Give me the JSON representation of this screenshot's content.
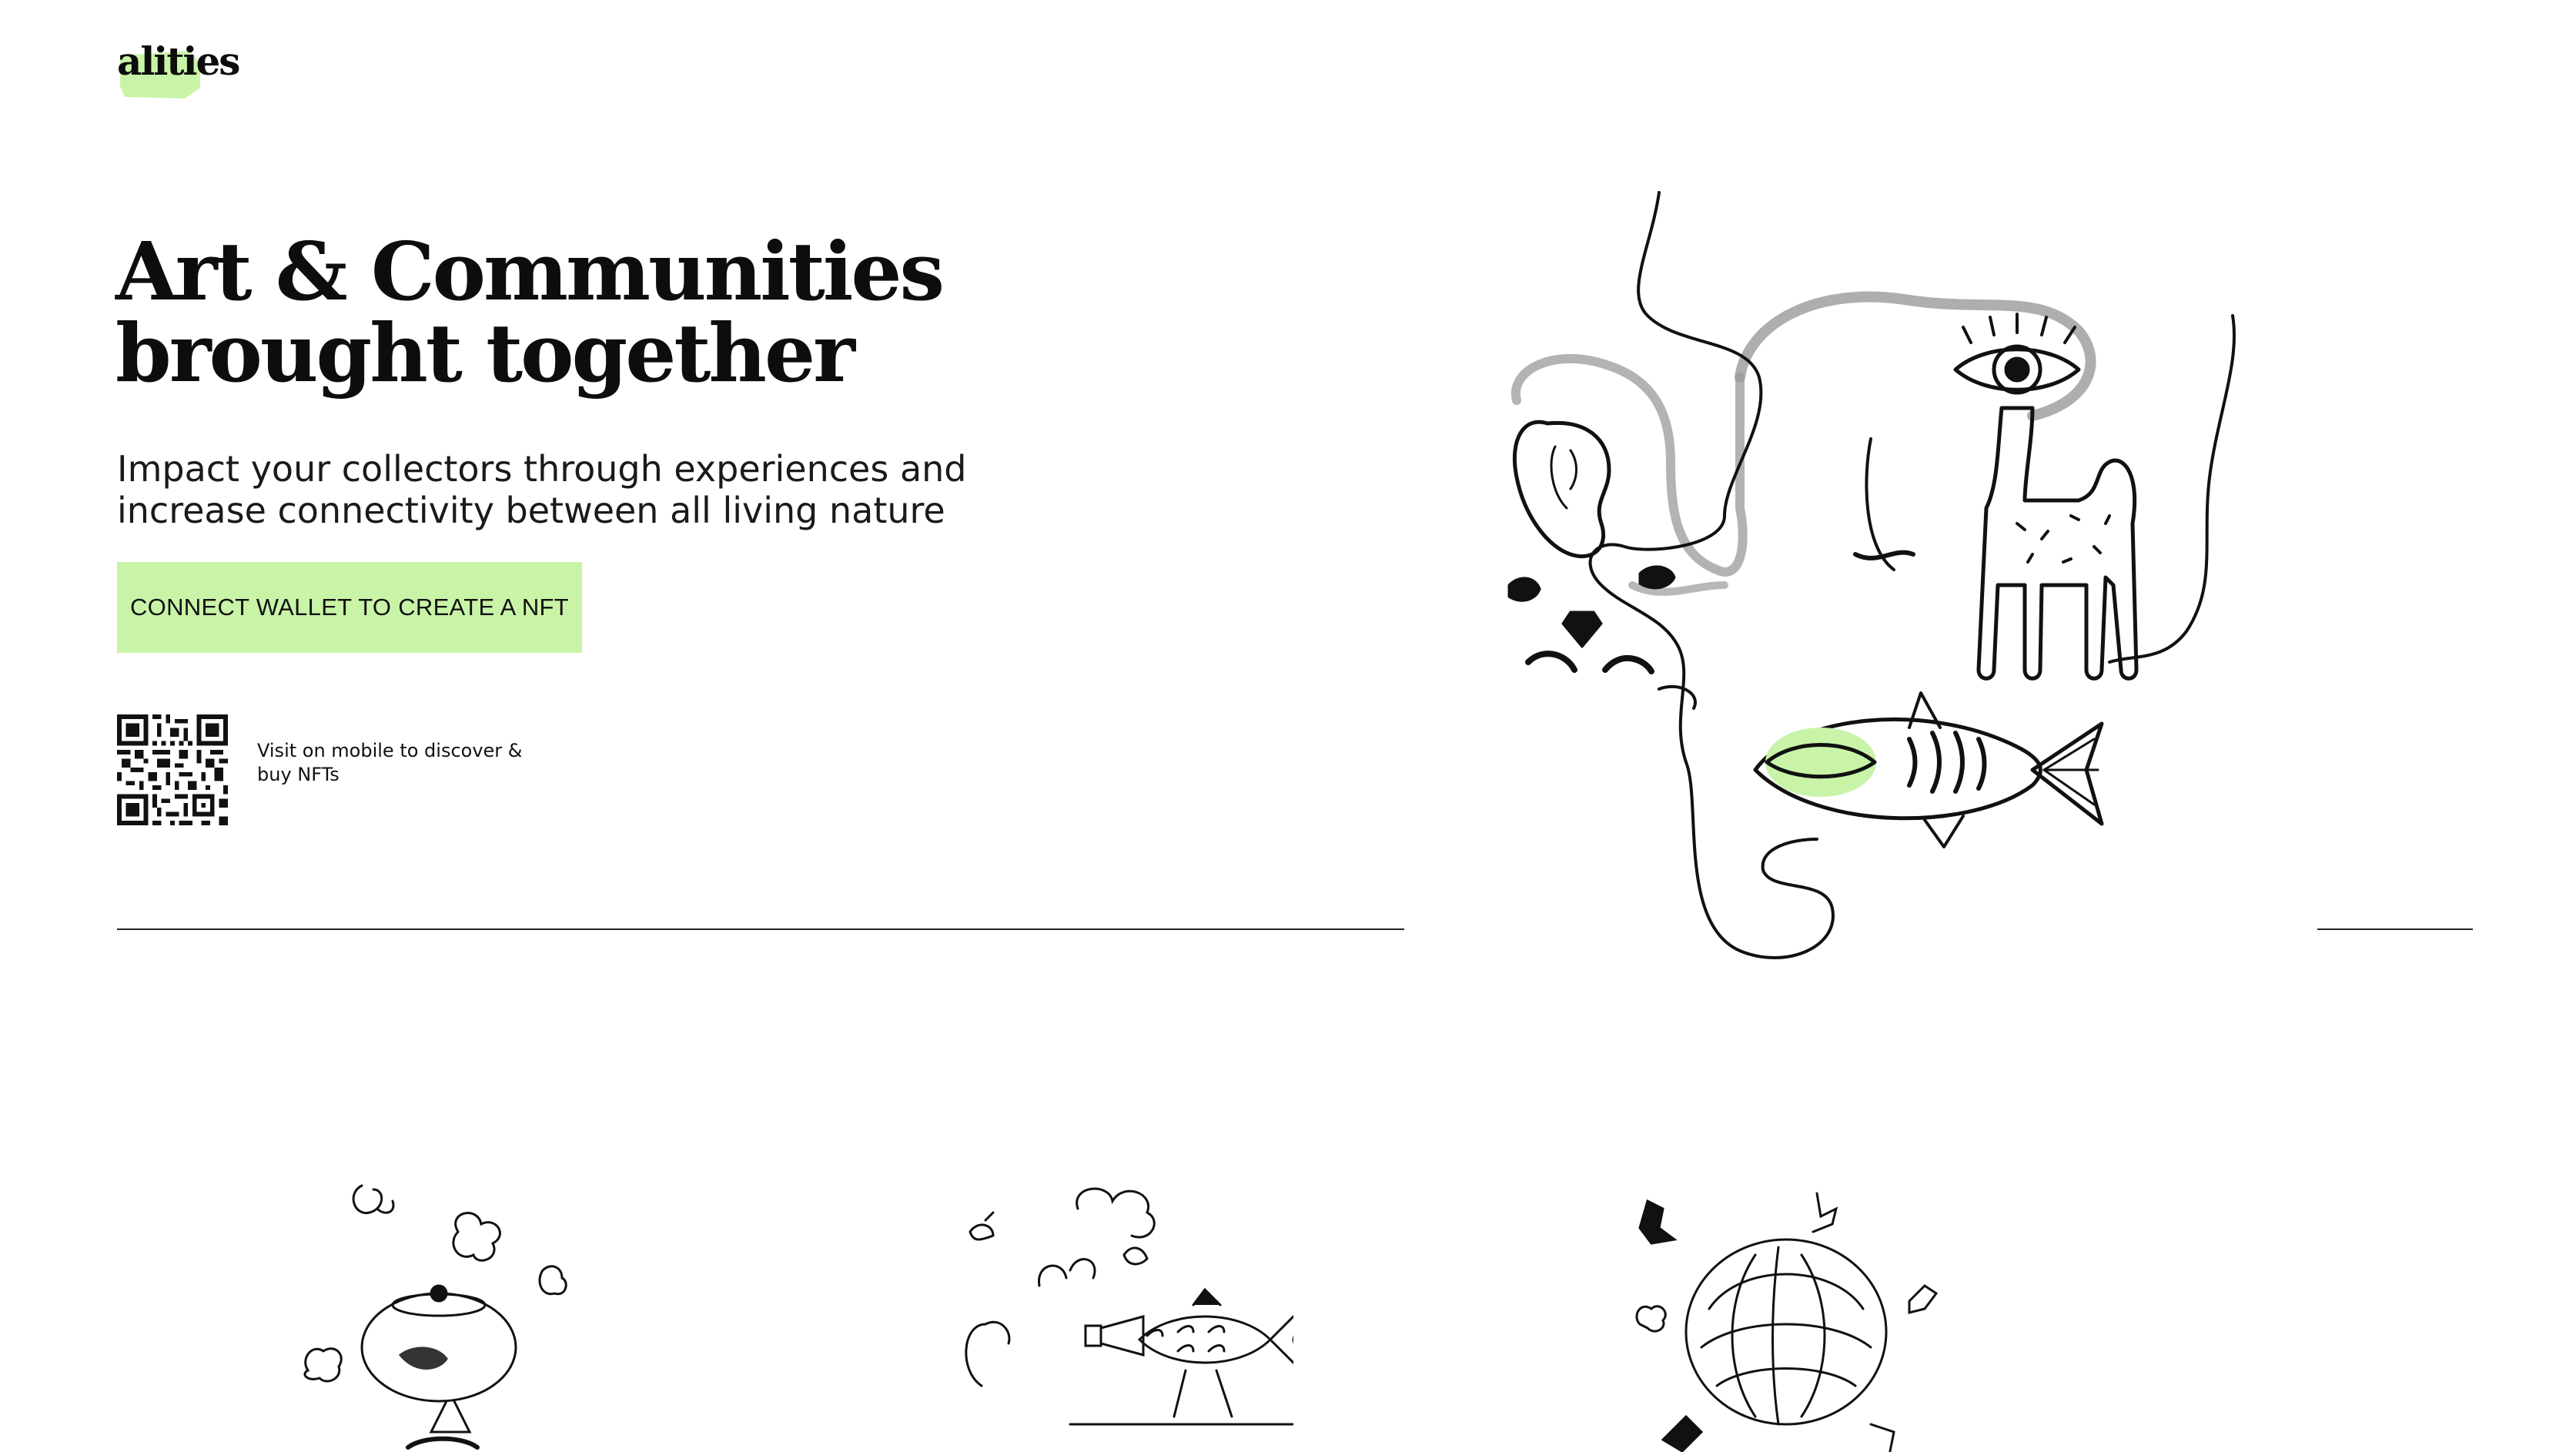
{
  "brand": {
    "logo_text": "alities",
    "accent_color": "#c9f4a8"
  },
  "hero": {
    "title_line1": "Art & Communities",
    "title_line2": "brought together",
    "subtitle_line1": "Impact your collectors through experiences and",
    "subtitle_line2": "increase connectivity between all living nature",
    "cta_label": "CONNECT WALLET TO CREATE A NFT"
  },
  "mobile": {
    "qr_icon": "qr-code-icon",
    "caption": "Visit on mobile to discover & buy NFTs"
  },
  "artwork": {
    "hero_illustration": "face-fish-llama-illustration",
    "thumbnails": [
      {
        "icon": "fishbowl-illustration"
      },
      {
        "icon": "fish-megaphone-illustration"
      },
      {
        "icon": "knot-of-arms-illustration"
      }
    ]
  }
}
